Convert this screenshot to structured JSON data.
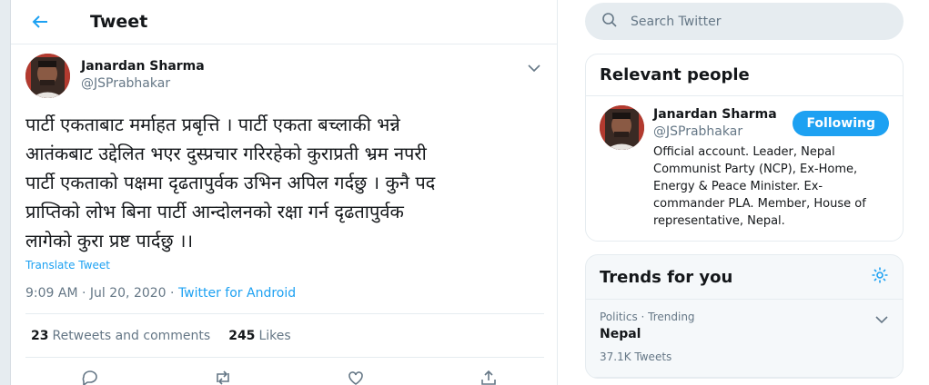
{
  "header": {
    "title": "Tweet",
    "back_icon": "arrow-left-icon"
  },
  "tweet": {
    "author": {
      "display_name": "Janardan Sharma",
      "handle": "@JSPrabhakar"
    },
    "text_lines": [
      "पार्टी एकताबाट मर्माहत प्रबृत्ति । पार्टी एकता बच्लाकी भन्ने",
      "आतंकबाट उद्देलित भएर दुस्प्रचार गरिरहेको कुराप्रती भ्रम नपरी",
      "पार्टी एकताको पक्षमा दृढतापुर्वक उभिन अपिल गर्दछु । कुनै पद",
      "प्राप्तिको लोभ बिना पार्टी आन्दोलनको रक्षा गर्न दृढतापुर्वक",
      "लागेको कुरा प्रष्ट पार्दछु ।।"
    ],
    "translate_label": "Translate Tweet",
    "timestamp": "9:09 AM · Jul 20, 2020 · ",
    "source": "Twitter for Android",
    "retweets_count": "23",
    "retweets_label": "Retweets and comments",
    "likes_count": "245",
    "likes_label": "Likes"
  },
  "search": {
    "placeholder": "Search Twitter"
  },
  "relevant_people": {
    "title": "Relevant people",
    "person": {
      "display_name": "Janardan Sharma",
      "handle": "@JSPrabhakar",
      "bio": "Official account. Leader, Nepal Communist Party (NCP), Ex-Home, Energy & Peace Minister. Ex-commander PLA. Member, House of representative, Nepal.",
      "follow_label": "Following"
    }
  },
  "trends": {
    "title": "Trends for you",
    "items": [
      {
        "context": "Politics · Trending",
        "name": "Nepal",
        "count": "37.1K Tweets"
      }
    ]
  },
  "colors": {
    "accent": "#1da1f2",
    "muted": "#657786",
    "border": "#e6ecf0"
  }
}
